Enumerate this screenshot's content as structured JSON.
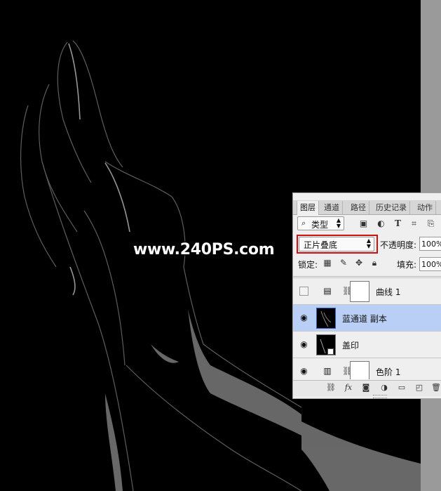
{
  "watermark": "www.240PS.com",
  "panel": {
    "tabs": [
      "图层",
      "通道",
      "路径",
      "历史记录",
      "动作"
    ],
    "active_tab": "图层",
    "filter": {
      "kind_label": "类型"
    },
    "blend_mode": "正片叠底",
    "opacity_label": "不透明度:",
    "opacity_value": "100%",
    "lock_label": "锁定:",
    "fill_label": "填充:",
    "fill_value": "100%",
    "layers": [
      {
        "name": "曲线 1",
        "visible": false,
        "type": "adjustment"
      },
      {
        "name": "蓝通道 副本",
        "visible": true,
        "selected": true,
        "type": "pixel"
      },
      {
        "name": "盖印",
        "visible": true,
        "type": "smart"
      },
      {
        "name": "色阶 1",
        "visible": true,
        "type": "adjustment"
      }
    ],
    "bottom_icons": [
      "link-icon",
      "fx-icon",
      "mask-icon",
      "adjustment-icon",
      "folder-icon",
      "new-layer-icon",
      "trash-icon"
    ]
  },
  "colors": {
    "canvas": "#000000",
    "panel_bg": "#efefef",
    "selected_row": "#b9cff5",
    "highlight_box": "#d01010",
    "side_strip": "#9a9a9a"
  }
}
